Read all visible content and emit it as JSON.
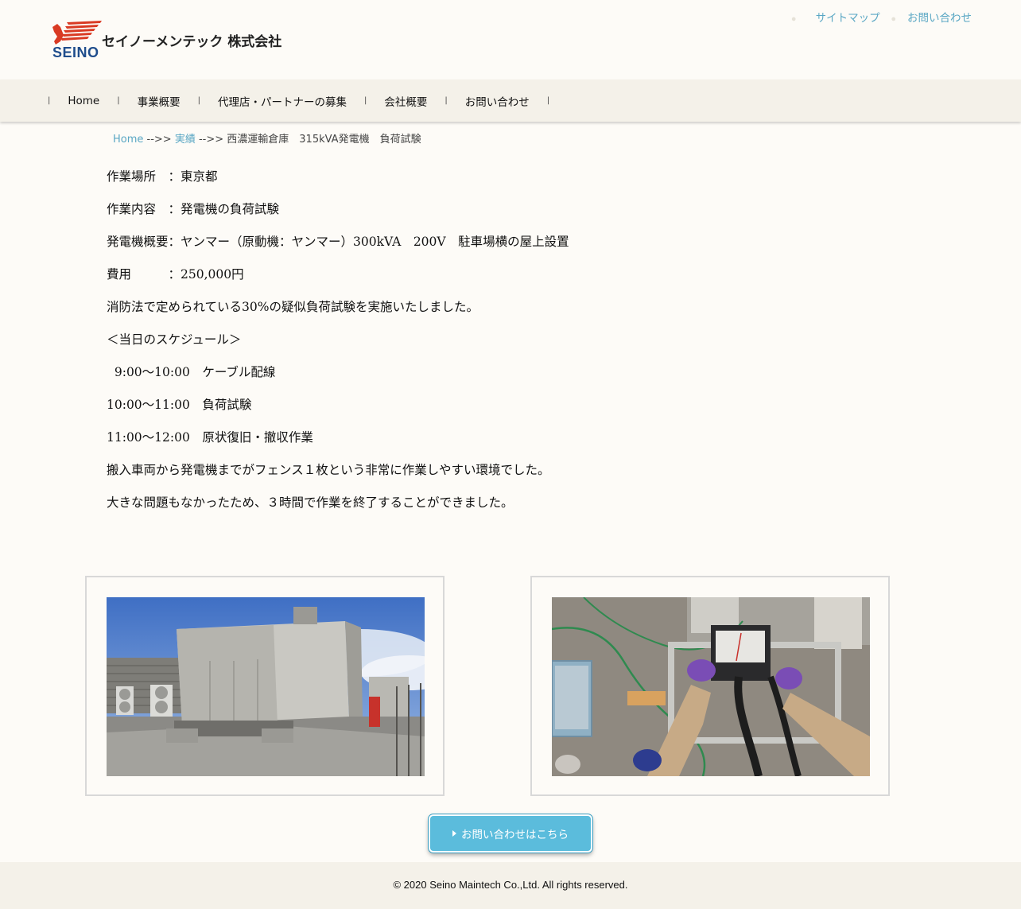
{
  "header": {
    "logo_text": "SEINO",
    "company_name": "セイノーメンテック 株式会社",
    "top_links": [
      "サイトマップ",
      "お問い合わせ"
    ]
  },
  "nav": {
    "items": [
      "Home",
      "事業概要",
      "代理店・パートナーの募集",
      "会社概要",
      "お問い合わせ"
    ]
  },
  "breadcrumb": {
    "home": "Home",
    "sep1": " -->> ",
    "category": "実績",
    "sep2": " -->> ",
    "current": "西濃運輸倉庫　315kVA発電機　負荷試験"
  },
  "article": {
    "lines": [
      "作業場所　：東京都",
      "作業内容　：発電機の負荷試験",
      "発電機概要：ヤンマー（原動機：ヤンマー）300kVA　200V　駐車場横の屋上設置",
      "費用　　　：250,000円",
      "消防法で定められている30%の疑似負荷試験を実施いたしました。",
      "＜当日のスケジュール＞",
      "  9:00～10:00　ケーブル配線",
      "10:00～11:00　負荷試験",
      "11:00～12:00　原状復旧・撤収作業",
      "搬入車両から発電機までがフェンス１枚という非常に作業しやすい環境でした。",
      "大きな問題もなかったため、３時間で作業を終了することができました。"
    ]
  },
  "cta": {
    "label": "お問い合わせはこちら"
  },
  "footer": {
    "copyright": "© 2020 Seino Maintech Co.,Ltd. All rights reserved."
  },
  "colors": {
    "link": "#5aa7c4",
    "nav_bg": "#f4f1e9",
    "page_bg": "#fdfbf7",
    "cta_bg": "#5bbcdc"
  }
}
